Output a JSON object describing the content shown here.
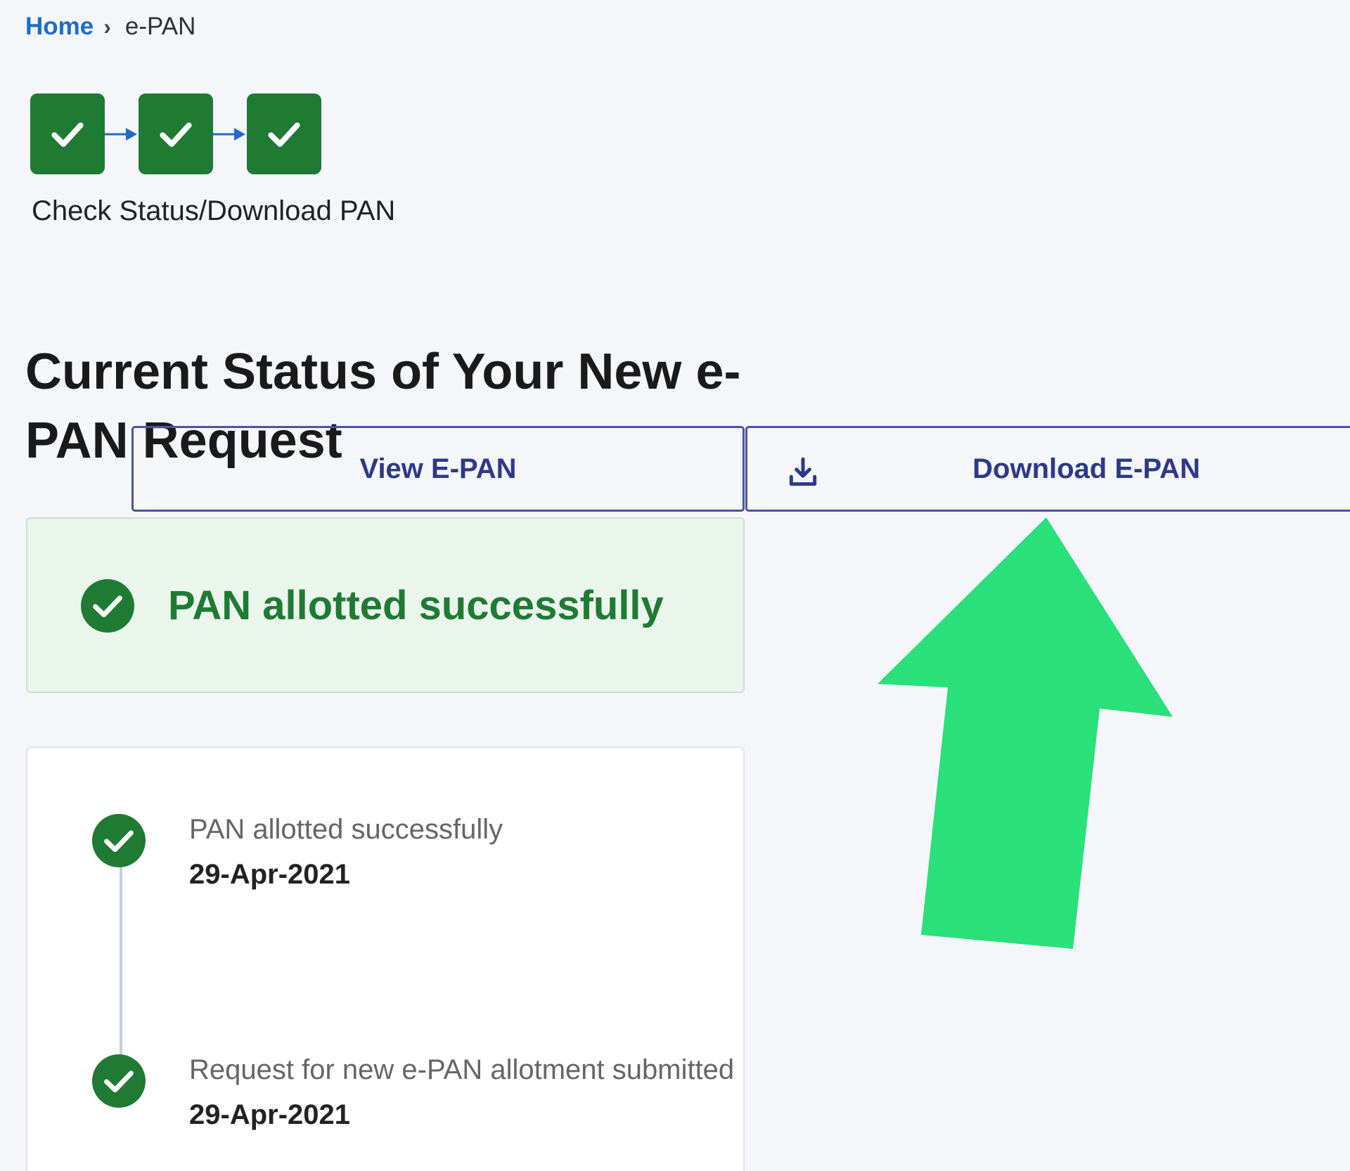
{
  "breadcrumb": {
    "home": "Home",
    "separator": "›",
    "current": "e-PAN"
  },
  "stepper": {
    "steps": [
      {
        "state": "complete",
        "icon": "check-icon"
      },
      {
        "state": "complete",
        "icon": "check-icon"
      },
      {
        "state": "complete",
        "icon": "check-icon"
      }
    ],
    "label": "Check Status/Download PAN"
  },
  "heading": "Current Status of Your New e-PAN Request",
  "actions": {
    "view_label": "View E-PAN",
    "download_label": "Download E-PAN",
    "download_icon": "download-icon"
  },
  "banner": {
    "icon": "check-circle-icon",
    "text": "PAN allotted successfully"
  },
  "timeline": [
    {
      "title": "PAN allotted successfully",
      "date": "29-Apr-2021"
    },
    {
      "title": "Request for new e-PAN allotment submitted",
      "date": "29-Apr-2021"
    }
  ],
  "colors": {
    "success_green": "#1f7a34",
    "link_blue": "#1e6ec8",
    "button_border": "#4d559e",
    "button_text": "#2e3a87",
    "annotation_arrow": "#2ae07a",
    "background": "#f4f6fa"
  }
}
